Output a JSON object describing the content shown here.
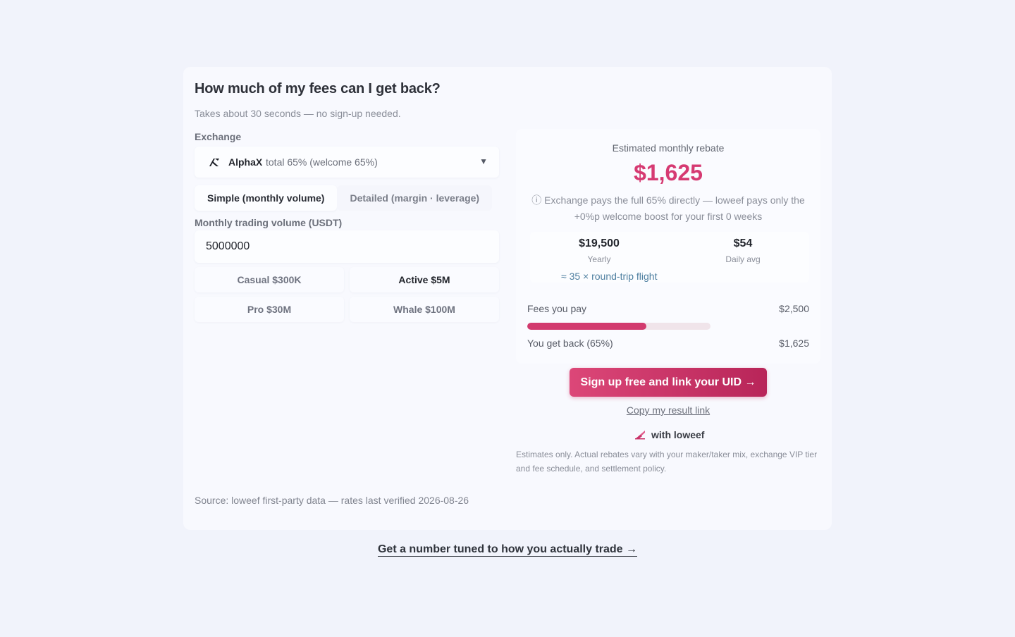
{
  "calculator": {
    "title": "How much of my fees can I get back?",
    "subtitle": "Takes about 30 seconds — no sign-up needed.",
    "exchange_label": "Exchange",
    "exchange": {
      "name": "AlphaX",
      "rate_text": "total 65% (welcome 65%)",
      "logo_icon": "alphax-logo-icon",
      "caret_icon": "caret-down-icon",
      "caret": "▼"
    },
    "modes": [
      {
        "label": "Simple (monthly volume)",
        "active": true
      },
      {
        "label": "Detailed (margin · leverage)",
        "active": false
      }
    ],
    "volume_label": "Monthly trading volume (USDT)",
    "volume_value": "5000000",
    "presets": [
      {
        "label": "Casual $300K",
        "active": false
      },
      {
        "label": "Active $5M",
        "active": true
      },
      {
        "label": "Pro $30M",
        "active": false
      },
      {
        "label": "Whale $100M",
        "active": false
      }
    ],
    "source": "Source: loweef first-party data — rates last verified 2026-08-26"
  },
  "result": {
    "label": "Estimated monthly rebate",
    "amount": "$1,625",
    "note": "ⓘ Exchange pays the full 65% directly — loweef pays only the +0%p welcome boost for your first 0 weeks",
    "yearly_value": "$19,500",
    "yearly_label": "Yearly",
    "daily_value": "$54",
    "daily_label": "Daily avg",
    "flight": "≈ 35 × round-trip flight",
    "fees_label": "Fees you pay",
    "fees_value": "$2,500",
    "back_label": "You get back (65%)",
    "back_value": "$1,625",
    "bar_fraction": 0.65,
    "accent": "#d63a72"
  },
  "actions": {
    "cta": "Sign up free and link your UID →",
    "copy": "Copy my result link",
    "brand": "with loweef",
    "brand_icon": "loweef-logo-icon"
  },
  "disclaimer": "Estimates only. Actual rebates vary with your maker/taker mix, exchange VIP tier and fee schedule, and settlement policy.",
  "bottom_link": "Get a number tuned to how you actually trade →"
}
